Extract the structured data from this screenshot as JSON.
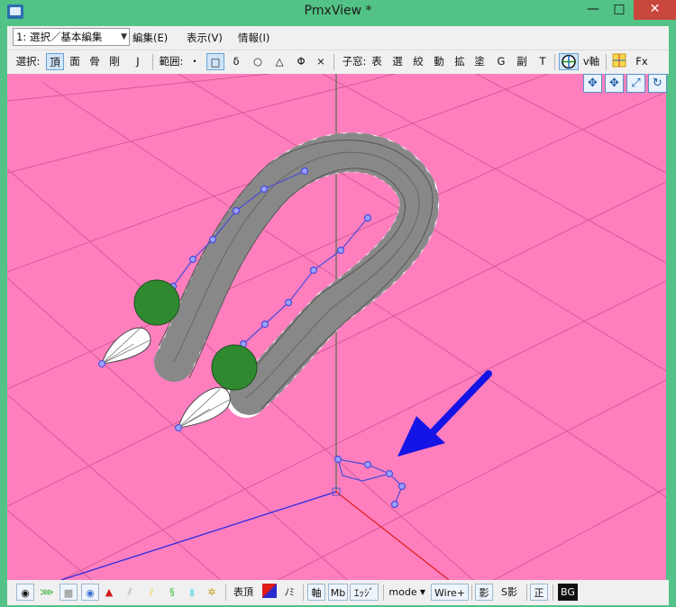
{
  "window": {
    "title": "PmxView *",
    "controls": {
      "minimize": "—",
      "maximize": "□",
      "close": "✕"
    }
  },
  "menu": {
    "mode_select": "1: 選択／基本編集",
    "items": [
      "編集(E)",
      "表示(V)",
      "情報(I)"
    ]
  },
  "toolbar": {
    "select_label": "選択:",
    "select_items": [
      "頂",
      "面",
      "骨",
      "剛",
      "J"
    ],
    "range_label": "範囲:",
    "range_items": [
      "・",
      "□",
      "δ",
      "○",
      "△",
      "Φ",
      "×"
    ],
    "child_label": "子窓:",
    "child_items": [
      "表",
      "選",
      "絞",
      "動",
      "拡",
      "塗",
      "G",
      "副",
      "T"
    ],
    "axis_label": "v軸",
    "fx_label": "Fx"
  },
  "view_controls": [
    "move-icon",
    "pan-icon",
    "zoom-icon",
    "rotate-icon"
  ],
  "bottombar": {
    "vertex_label": "表頂",
    "mi_label": "ﾉﾐ",
    "axis_button": "軸",
    "mb_button": "Mb",
    "edge_button": "ｴｯｼﾞ",
    "mode_button": "mode",
    "wire_button": "Wire+",
    "shadow_button": "影",
    "sshadow_button": "S影",
    "ortho_button": "正",
    "bg_button": "BG"
  },
  "colors": {
    "viewport_bg": "#ff7fbe",
    "window_frame": "#53c286",
    "arrow": "#1414e6",
    "axis_blue": "#2a2ae0",
    "axis_red": "#e02020",
    "bone_sphere": "#2f8a2f"
  }
}
